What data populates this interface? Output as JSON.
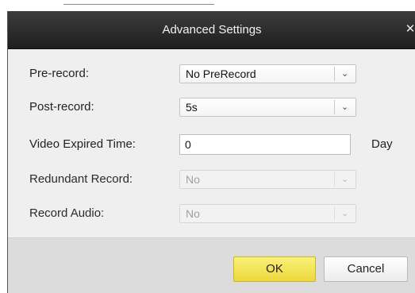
{
  "dialog": {
    "title": "Advanced Settings",
    "close_glyph": "✕"
  },
  "fields": {
    "pre_record": {
      "label": "Pre-record:",
      "value": "No PreRecord"
    },
    "post_record": {
      "label": "Post-record:",
      "value": "5s"
    },
    "video_expired_time": {
      "label": "Video Expired Time:",
      "value": "0",
      "unit": "Day"
    },
    "redundant_record": {
      "label": "Redundant Record:",
      "value": "No"
    },
    "record_audio": {
      "label": "Record Audio:",
      "value": "No"
    }
  },
  "dropdown_arrow_glyph": "⌄",
  "buttons": {
    "ok": "OK",
    "cancel": "Cancel"
  },
  "colors": {
    "title_bar": "#2b2b2b",
    "ok_button": "#f5e658",
    "dialog_body": "#efefef"
  }
}
